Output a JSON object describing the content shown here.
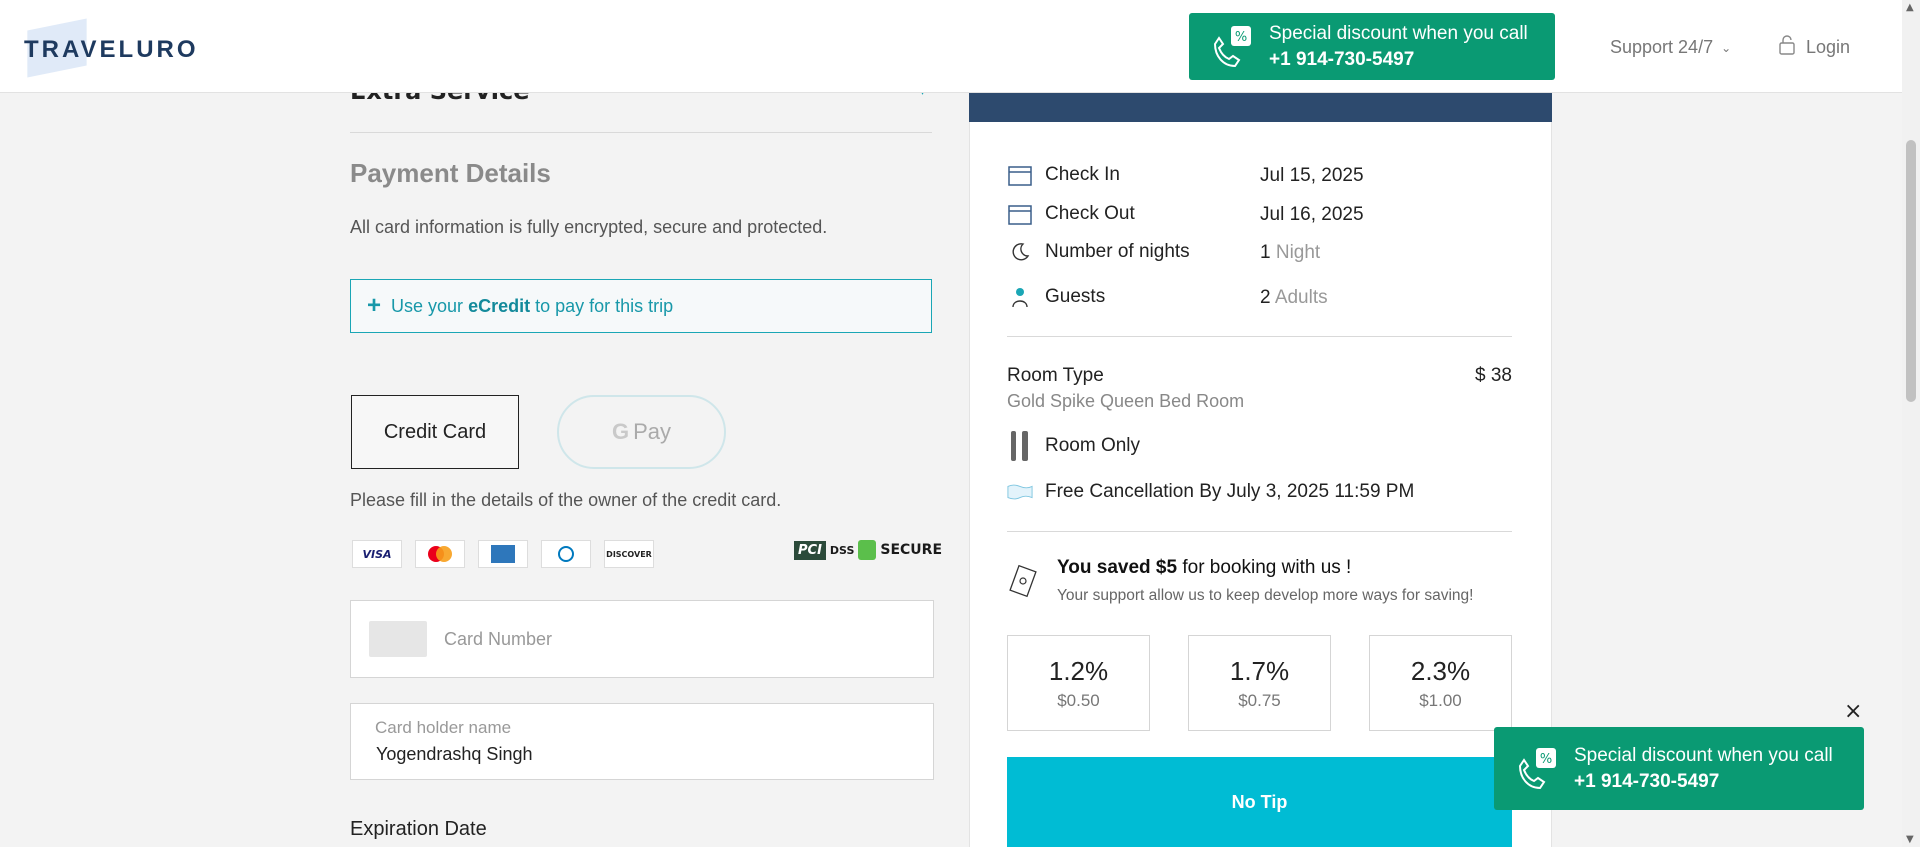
{
  "header": {
    "logo": "TRAVELURO",
    "promo_line1": "Special discount when you call",
    "promo_phone": "+1 914-730-5497",
    "support_label": "Support 24/7",
    "login_label": "Login"
  },
  "left": {
    "extra_service": "Extra Service",
    "payment_title": "Payment Details",
    "payment_sub": "All card information is fully encrypted, secure and protected.",
    "ecredit_prefix": "Use your",
    "ecredit_bold": "eCredit",
    "ecredit_suffix": "to pay for this trip",
    "credit_card_btn": "Credit Card",
    "gpay_g": "G",
    "gpay_label": "Pay",
    "owner_note": "Please fill in the details of the owner of the credit card.",
    "card_logos": [
      "VISA",
      "MC",
      "AMEX",
      "DINERS",
      "DISCOVER"
    ],
    "pci_label": "PCI",
    "dss_label": "DSS",
    "secure_label": "SECURE",
    "card_number_placeholder": "Card Number",
    "holder_label": "Card holder name",
    "holder_value": "Yogendrashq Singh",
    "expiration_title": "Expiration Date"
  },
  "right": {
    "check_in_label": "Check In",
    "check_in_value": "Jul 15, 2025",
    "check_out_label": "Check Out",
    "check_out_value": "Jul 16, 2025",
    "nights_label": "Number of nights",
    "nights_count": "1",
    "nights_unit": "Night",
    "guests_label": "Guests",
    "guests_count": "2",
    "guests_unit": "Adults",
    "room_type_label": "Room Type",
    "room_type_value": "Gold Spike Queen Bed Room",
    "room_price": "$ 38",
    "meal_plan": "Room Only",
    "cancellation": "Free Cancellation By July 3, 2025 11:59 PM",
    "saved_prefix": "You saved",
    "saved_amount": "$5",
    "saved_suffix": "for booking with us !",
    "saved_sub": "Your support allow us to keep develop more ways for saving!",
    "tips": [
      {
        "pct": "1.2%",
        "amt": "$0.50"
      },
      {
        "pct": "1.7%",
        "amt": "$0.75"
      },
      {
        "pct": "2.3%",
        "amt": "$1.00"
      }
    ],
    "no_tip": "No Tip"
  },
  "popup": {
    "line1": "Special discount when you call",
    "phone": "+1 914-730-5497",
    "close": "×"
  },
  "colors": {
    "brand_navy": "#2d4a6e",
    "promo_green": "#0a9a73",
    "accent_teal": "#1aa6b5",
    "no_tip_cyan": "#00bcd4"
  }
}
